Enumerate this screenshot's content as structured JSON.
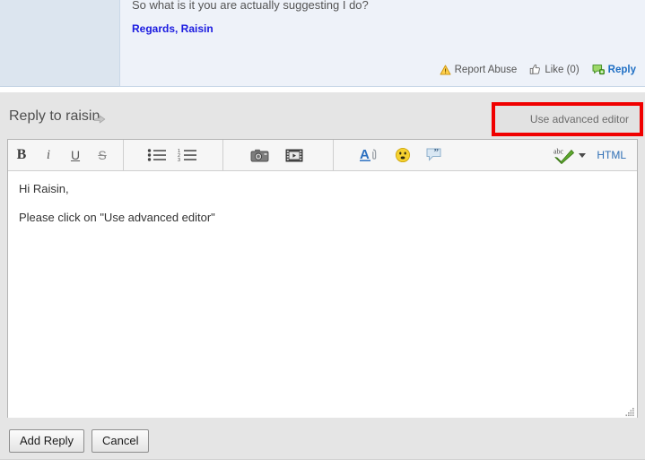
{
  "post": {
    "message": "So what is it you are actually suggesting I do?",
    "signature": "Regards, Raisin",
    "actions": [
      {
        "label": "Report Abuse",
        "icon": "warning-triangle-icon",
        "style": "gray"
      },
      {
        "label": "Like (0)",
        "icon": "thumbs-up-icon",
        "style": "gray"
      },
      {
        "label": "Reply",
        "icon": "reply-bubble-icon",
        "style": "blue"
      }
    ]
  },
  "reply": {
    "title": "Reply to raisin",
    "title_icon": "share-arrow-icon",
    "advanced_editor_label": "Use advanced editor",
    "highlight_color": "#f00000"
  },
  "toolbar": {
    "groups": [
      {
        "name": "formatting",
        "buttons": [
          {
            "name": "bold-button",
            "glyph": "B",
            "style": "b",
            "title": "Bold"
          },
          {
            "name": "italic-button",
            "glyph": "i",
            "style": "i",
            "title": "Italic"
          },
          {
            "name": "underline-button",
            "glyph": "U",
            "style": "u",
            "title": "Underline"
          },
          {
            "name": "strikethrough-button",
            "glyph": "S",
            "style": "s",
            "title": "Strikethrough"
          }
        ]
      },
      {
        "name": "lists",
        "buttons": [
          {
            "name": "bulleted-list-button",
            "icon": "bulleted-list-icon",
            "title": "Bulleted list"
          },
          {
            "name": "numbered-list-button",
            "icon": "numbered-list-icon",
            "title": "Numbered list"
          }
        ]
      },
      {
        "name": "media",
        "buttons": [
          {
            "name": "insert-image-button",
            "icon": "camera-icon",
            "title": "Insert image"
          },
          {
            "name": "insert-video-button",
            "icon": "video-icon",
            "title": "Insert video"
          }
        ]
      },
      {
        "name": "insert",
        "buttons": [
          {
            "name": "insert-link-button",
            "icon": "link-icon",
            "title": "Insert link"
          },
          {
            "name": "insert-emoji-button",
            "icon": "smiley-icon",
            "title": "Insert emoticon"
          },
          {
            "name": "insert-quote-button",
            "icon": "quote-icon",
            "title": "Quote"
          }
        ]
      }
    ],
    "spellcheck": {
      "name": "spellcheck-button",
      "icon": "spellcheck-abc-icon",
      "dropdown_icon": "chevron-down-icon"
    },
    "html_label": "HTML"
  },
  "editor": {
    "lines": [
      "Hi Raisin,",
      "Please click on \"Use advanced editor\""
    ],
    "resize_icon": "resize-grip-icon"
  },
  "footer": {
    "submit_label": "Add Reply",
    "cancel_label": "Cancel"
  }
}
